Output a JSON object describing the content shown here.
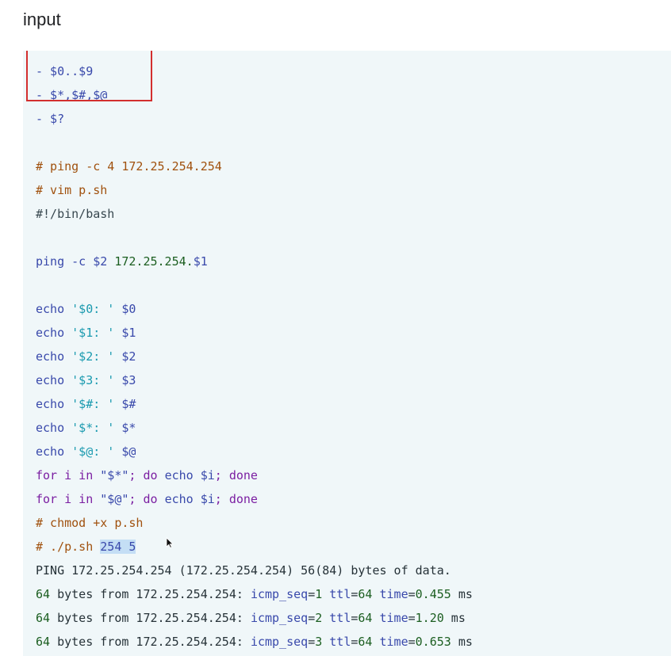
{
  "heading": "input",
  "lines": [
    [
      {
        "t": "- $0..$9",
        "c": "c-blue"
      }
    ],
    [
      {
        "t": "- $*,$#,$@",
        "c": "c-blue"
      }
    ],
    [
      {
        "t": "- $?",
        "c": "c-blue"
      }
    ],
    [],
    [
      {
        "t": "# ping -c 4 172.25.254.254",
        "c": "c-comment"
      }
    ],
    [
      {
        "t": "# vim p.sh",
        "c": "c-comment"
      }
    ],
    [
      {
        "t": "#!/bin/bash",
        "c": "c-plain"
      }
    ],
    [],
    [
      {
        "t": "ping -c ",
        "c": "c-blue"
      },
      {
        "t": "$2",
        "c": "c-blue"
      },
      {
        "t": " 172.25.254.",
        "c": "c-green"
      },
      {
        "t": "$1",
        "c": "c-blue"
      }
    ],
    [],
    [
      {
        "t": "echo ",
        "c": "c-blue"
      },
      {
        "t": "'$0: '",
        "c": "c-str"
      },
      {
        "t": " $0",
        "c": "c-blue"
      }
    ],
    [
      {
        "t": "echo ",
        "c": "c-blue"
      },
      {
        "t": "'$1: '",
        "c": "c-str"
      },
      {
        "t": " $1",
        "c": "c-blue"
      }
    ],
    [
      {
        "t": "echo ",
        "c": "c-blue"
      },
      {
        "t": "'$2: '",
        "c": "c-str"
      },
      {
        "t": " $2",
        "c": "c-blue"
      }
    ],
    [
      {
        "t": "echo ",
        "c": "c-blue"
      },
      {
        "t": "'$3: '",
        "c": "c-str"
      },
      {
        "t": " $3",
        "c": "c-blue"
      }
    ],
    [
      {
        "t": "echo ",
        "c": "c-blue"
      },
      {
        "t": "'$#: '",
        "c": "c-str"
      },
      {
        "t": " $#",
        "c": "c-blue"
      }
    ],
    [
      {
        "t": "echo ",
        "c": "c-blue"
      },
      {
        "t": "'$*: '",
        "c": "c-str"
      },
      {
        "t": " $*",
        "c": "c-blue"
      }
    ],
    [
      {
        "t": "echo ",
        "c": "c-blue"
      },
      {
        "t": "'$@: '",
        "c": "c-str"
      },
      {
        "t": " $@",
        "c": "c-blue"
      }
    ],
    [
      {
        "t": "for i in ",
        "c": "c-purple"
      },
      {
        "t": "\"$*\"",
        "c": "c-blue"
      },
      {
        "t": "; do ",
        "c": "c-purple"
      },
      {
        "t": "echo ",
        "c": "c-blue"
      },
      {
        "t": "$i",
        "c": "c-blue"
      },
      {
        "t": "; done",
        "c": "c-purple"
      }
    ],
    [
      {
        "t": "for i in ",
        "c": "c-purple"
      },
      {
        "t": "\"$@\"",
        "c": "c-blue"
      },
      {
        "t": "; do ",
        "c": "c-purple"
      },
      {
        "t": "echo ",
        "c": "c-blue"
      },
      {
        "t": "$i",
        "c": "c-blue"
      },
      {
        "t": "; done",
        "c": "c-purple"
      }
    ],
    [
      {
        "t": "# chmod +x p.sh",
        "c": "c-comment"
      }
    ],
    [
      {
        "t": "# ./p.sh ",
        "c": "c-comment"
      },
      {
        "t": "254 5",
        "c": "c-blue sel"
      }
    ],
    [
      {
        "t": "PING 172.25.254.254 (172.25.254.254) 56(84) bytes of data.",
        "c": "c-dark"
      }
    ],
    [
      {
        "t": "64",
        "c": "c-green"
      },
      {
        "t": " bytes from 172.25.254.254: ",
        "c": "c-dark"
      },
      {
        "t": "icmp_seq",
        "c": "c-blue"
      },
      {
        "t": "=",
        "c": "c-dark"
      },
      {
        "t": "1",
        "c": "c-green"
      },
      {
        "t": " ",
        "c": "c-dark"
      },
      {
        "t": "ttl",
        "c": "c-blue"
      },
      {
        "t": "=",
        "c": "c-dark"
      },
      {
        "t": "64",
        "c": "c-green"
      },
      {
        "t": " ",
        "c": "c-dark"
      },
      {
        "t": "time",
        "c": "c-blue"
      },
      {
        "t": "=",
        "c": "c-dark"
      },
      {
        "t": "0.455",
        "c": "c-green"
      },
      {
        "t": " ms",
        "c": "c-dark"
      }
    ],
    [
      {
        "t": "64",
        "c": "c-green"
      },
      {
        "t": " bytes from 172.25.254.254: ",
        "c": "c-dark"
      },
      {
        "t": "icmp_seq",
        "c": "c-blue"
      },
      {
        "t": "=",
        "c": "c-dark"
      },
      {
        "t": "2",
        "c": "c-green"
      },
      {
        "t": " ",
        "c": "c-dark"
      },
      {
        "t": "ttl",
        "c": "c-blue"
      },
      {
        "t": "=",
        "c": "c-dark"
      },
      {
        "t": "64",
        "c": "c-green"
      },
      {
        "t": " ",
        "c": "c-dark"
      },
      {
        "t": "time",
        "c": "c-blue"
      },
      {
        "t": "=",
        "c": "c-dark"
      },
      {
        "t": "1.20",
        "c": "c-green"
      },
      {
        "t": " ms",
        "c": "c-dark"
      }
    ],
    [
      {
        "t": "64",
        "c": "c-green"
      },
      {
        "t": " bytes from 172.25.254.254: ",
        "c": "c-dark"
      },
      {
        "t": "icmp_seq",
        "c": "c-blue"
      },
      {
        "t": "=",
        "c": "c-dark"
      },
      {
        "t": "3",
        "c": "c-green"
      },
      {
        "t": " ",
        "c": "c-dark"
      },
      {
        "t": "ttl",
        "c": "c-blue"
      },
      {
        "t": "=",
        "c": "c-dark"
      },
      {
        "t": "64",
        "c": "c-green"
      },
      {
        "t": " ",
        "c": "c-dark"
      },
      {
        "t": "time",
        "c": "c-blue"
      },
      {
        "t": "=",
        "c": "c-dark"
      },
      {
        "t": "0.653",
        "c": "c-green"
      },
      {
        "t": " ms",
        "c": "c-dark"
      }
    ]
  ],
  "colors": {
    "code_background": "#f0f7f9",
    "highlight_border": "#d32f2f",
    "selection": "#c4def5"
  }
}
